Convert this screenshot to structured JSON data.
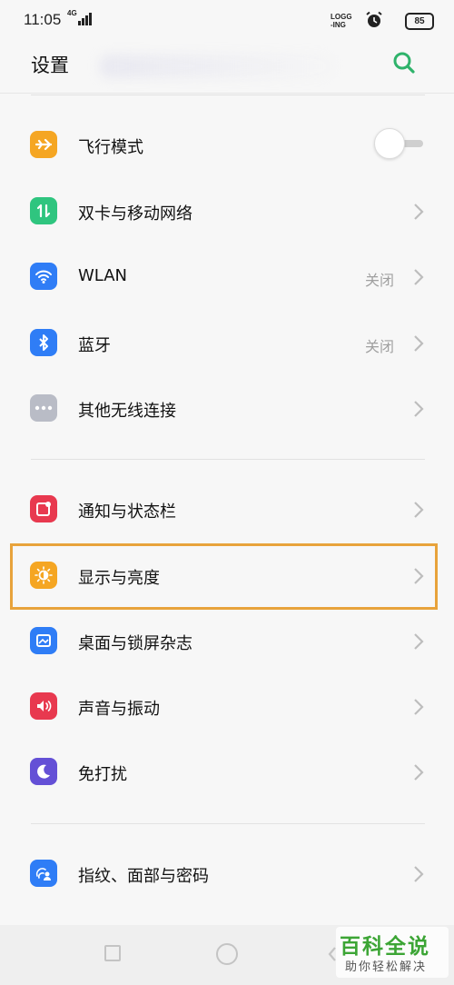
{
  "status_bar": {
    "time": "11:05",
    "network": "4G",
    "logging_line1": "LOGG",
    "logging_line2": "-ING",
    "battery": "85"
  },
  "header": {
    "title": "设置",
    "search_icon": "search-icon",
    "accent_color": "#2fb36b"
  },
  "groups": [
    {
      "items": [
        {
          "label": "飞行模式",
          "icon": "airplane-icon",
          "icon_color": "#f5a623",
          "control": "toggle",
          "toggle_on": false
        },
        {
          "label": "双卡与移动网络",
          "icon": "mobile-data-icon",
          "icon_color": "#2fc57f",
          "control": "chevron"
        },
        {
          "label": "WLAN",
          "icon": "wifi-icon",
          "icon_color": "#2f7df6",
          "value": "关闭",
          "control": "chevron"
        },
        {
          "label": "蓝牙",
          "icon": "bluetooth-icon",
          "icon_color": "#2f7df6",
          "value": "关闭",
          "control": "chevron"
        },
        {
          "label": "其他无线连接",
          "icon": "more-connections-icon",
          "icon_color": "#b9bcc6",
          "control": "chevron"
        }
      ]
    },
    {
      "items": [
        {
          "label": "通知与状态栏",
          "icon": "notification-icon",
          "icon_color": "#e8394f",
          "control": "chevron"
        },
        {
          "label": "显示与亮度",
          "icon": "brightness-icon",
          "icon_color": "#f5a623",
          "control": "chevron",
          "highlighted": true
        },
        {
          "label": "桌面与锁屏杂志",
          "icon": "wallpaper-icon",
          "icon_color": "#2f7df6",
          "control": "chevron"
        },
        {
          "label": "声音与振动",
          "icon": "sound-icon",
          "icon_color": "#e8394f",
          "control": "chevron"
        },
        {
          "label": "免打扰",
          "icon": "moon-icon",
          "icon_color": "#6450d6",
          "control": "chevron"
        }
      ]
    },
    {
      "items": [
        {
          "label": "指纹、面部与密码",
          "icon": "fingerprint-face-icon",
          "icon_color": "#2f7df6",
          "control": "chevron"
        }
      ]
    }
  ],
  "highlight_color": "#e8a33b",
  "watermark": {
    "title": "百科全说",
    "subtitle": "助你轻松解决"
  }
}
